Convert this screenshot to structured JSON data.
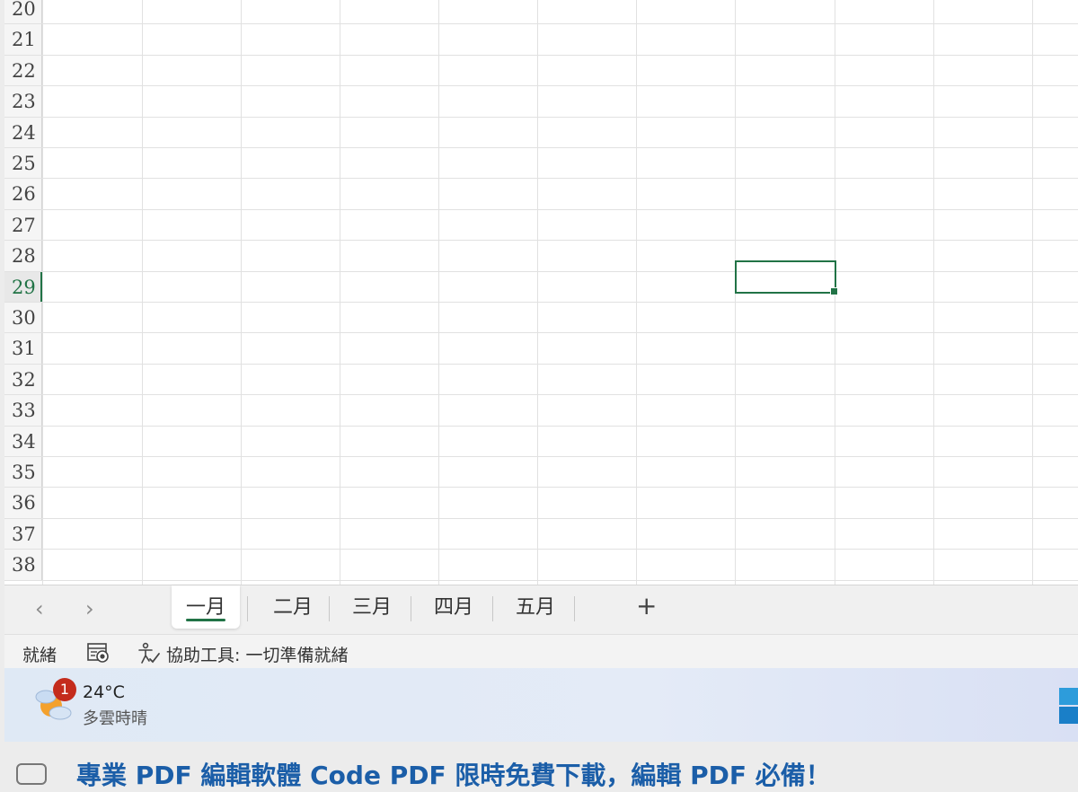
{
  "rows": [
    "20",
    "21",
    "22",
    "23",
    "24",
    "25",
    "26",
    "27",
    "28",
    "29",
    "30",
    "31",
    "32",
    "33",
    "34",
    "35",
    "36",
    "37",
    "38"
  ],
  "active_row": "29",
  "sheet_tabs": [
    "一月",
    "二月",
    "三月",
    "四月",
    "五月"
  ],
  "active_sheet": "一月",
  "tab_nav": {
    "prev": "‹",
    "next": "›",
    "add": "+"
  },
  "status": {
    "ready": "就緒",
    "accessibility": "協助工具: 一切準備就緒"
  },
  "weather": {
    "badge": "1",
    "temperature": "24°C",
    "condition": "多雲時晴"
  },
  "background_headline": "專業 PDF 編輯軟體 Code PDF 限時免費下載，編輯 PDF 必備！",
  "colors": {
    "accent": "#217346",
    "badge": "#c42b1c"
  }
}
